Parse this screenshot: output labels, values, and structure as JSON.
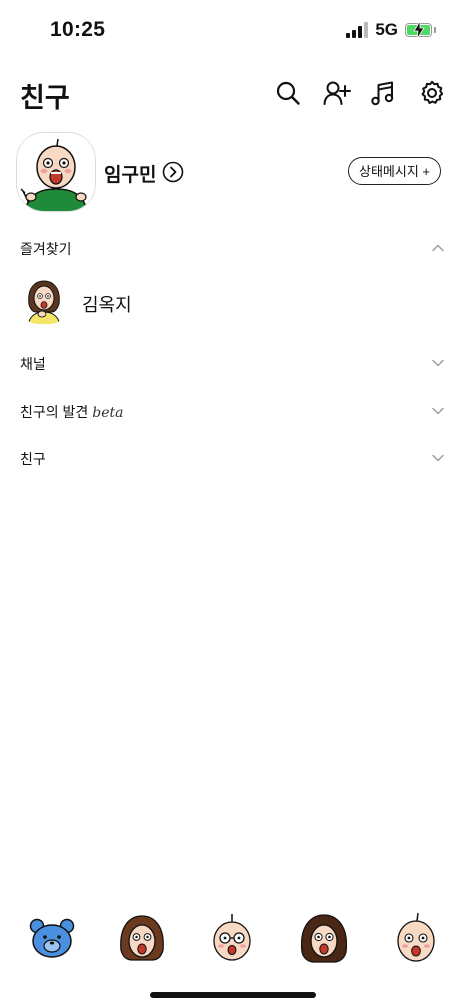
{
  "status_bar": {
    "time": "10:25",
    "network": "5G"
  },
  "header": {
    "title": "친구",
    "icons": [
      "search-icon",
      "add-friend-icon",
      "music-icon",
      "settings-icon"
    ]
  },
  "profile": {
    "name": "임구민",
    "status_button_label": "상태메시지 +"
  },
  "sections": {
    "favorites": {
      "label": "즐겨찾기",
      "expanded": true
    },
    "channels": {
      "label": "채널",
      "expanded": false
    },
    "discover": {
      "label": "친구의 발견",
      "badge": "beta",
      "expanded": false
    },
    "friends": {
      "label": "친구",
      "expanded": false
    }
  },
  "favorites_list": [
    {
      "name": "김옥지"
    }
  ],
  "tabbar": {
    "tabs": [
      "tab-bear",
      "tab-girl",
      "tab-glasses",
      "tab-girl-2",
      "tab-boy"
    ]
  },
  "colors": {
    "accent": "#4a8fe0",
    "battery": "#4cd964",
    "profile_shirt": "#1f8a3a",
    "friend_shirt": "#f5e66a"
  }
}
